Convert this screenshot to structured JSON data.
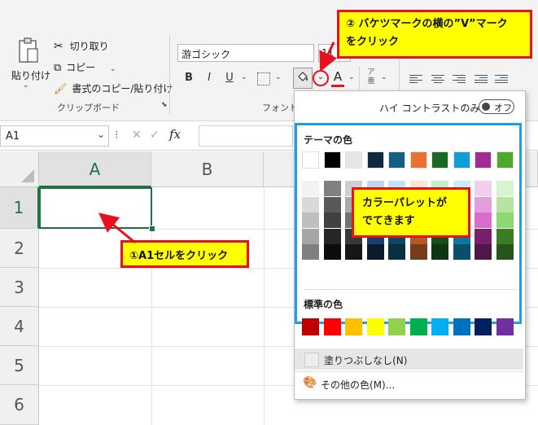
{
  "ribbon": {
    "paste": {
      "label": "貼り付け"
    },
    "cut": {
      "label": "切り取り"
    },
    "copy": {
      "label": "コピー"
    },
    "format_painter": {
      "label": "書式のコピー/貼り付け"
    },
    "clipboard_group": "クリップボード",
    "font_name": "游ゴシック",
    "font_size": "11",
    "bold": "B",
    "italic": "I",
    "underline": "U",
    "font_color_letter": "A",
    "font_group": "フォント",
    "font_color": "#e81123"
  },
  "formula_bar": {
    "name_box": "A1",
    "fx": "fx",
    "cancel": "✕",
    "enter": "✓"
  },
  "grid": {
    "columns": [
      "A",
      "B"
    ],
    "rows": [
      "1",
      "2",
      "3",
      "4",
      "5",
      "6"
    ],
    "selected_cell": "A1"
  },
  "palette": {
    "high_contrast_label": "ハイ コントラストのみ(H)",
    "toggle_state": "オフ",
    "theme_title": "テーマの色",
    "theme_colors": [
      [
        "#ffffff",
        "#f2f2f2",
        "#d9d9d9",
        "#bfbfbf",
        "#a6a6a6",
        "#808080"
      ],
      [
        "#000000",
        "#808080",
        "#595959",
        "#404040",
        "#262626",
        "#0d0d0d"
      ],
      [
        "#e7e6e6",
        "#d0cece",
        "#aeaaaa",
        "#757171",
        "#3a3838",
        "#161616"
      ],
      [
        "#0e2841",
        "#c0d6ee",
        "#8fb1df",
        "#4e7dbf",
        "#1b3f6b",
        "#0a1b2e"
      ],
      [
        "#156082",
        "#c1e4f5",
        "#83c9ec",
        "#45aee2",
        "#104863",
        "#093041"
      ],
      [
        "#e97132",
        "#fbe3d6",
        "#f7c7ad",
        "#f3aa83",
        "#b35926",
        "#773b19"
      ],
      [
        "#196b24",
        "#c1f0c8",
        "#83e291",
        "#4dd25c",
        "#134f1b",
        "#0c3512"
      ],
      [
        "#0f9ed5",
        "#caedfb",
        "#95dcf7",
        "#61cbf3",
        "#0b76a0",
        "#074f6a"
      ],
      [
        "#a02b93",
        "#f2cfee",
        "#e49edd",
        "#d86dcd",
        "#78206e",
        "#501549"
      ],
      [
        "#4ea72e",
        "#d9f2d0",
        "#b4e5a2",
        "#8ed873",
        "#3b7d23",
        "#275418"
      ]
    ],
    "standard_title": "標準の色",
    "standard_colors": [
      "#c00000",
      "#ff0000",
      "#ffc000",
      "#ffff00",
      "#92d050",
      "#00b050",
      "#00b0f0",
      "#0070c0",
      "#002060",
      "#7030a0"
    ],
    "no_fill_label": "塗りつぶしなし(N)",
    "more_colors_label": "その他の色(M)..."
  },
  "callouts": {
    "step2_line1": "② バケツマークの横の”V”マーク",
    "step2_line2": "をクリック",
    "step1": "①A1セルをクリック",
    "palette_note_line1": "カラーパレットが",
    "palette_note_line2": "でてきます"
  },
  "colors": {
    "accent_blue": "#1ca1e2",
    "callout_red": "#e8101c",
    "callout_yellow": "#ffff00",
    "excel_green": "#217346"
  }
}
